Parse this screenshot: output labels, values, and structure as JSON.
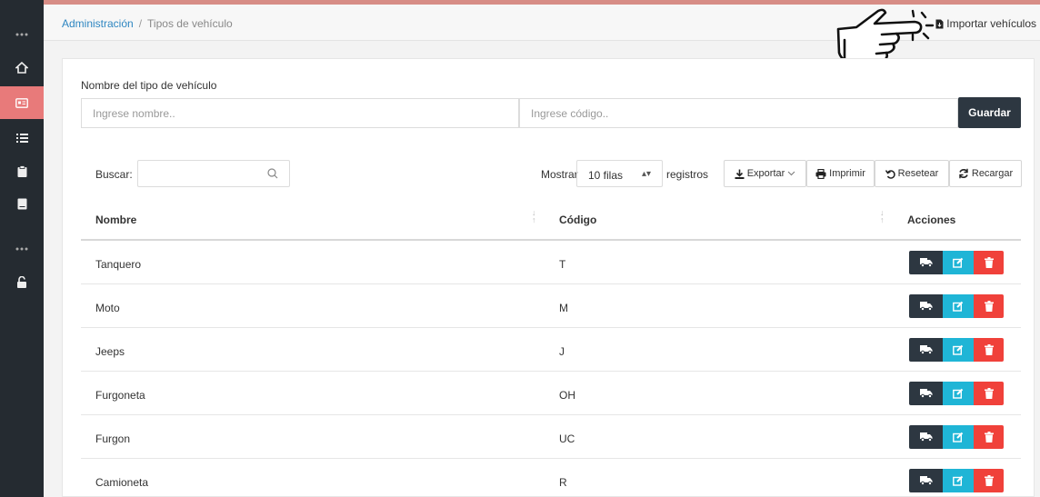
{
  "breadcrumb": {
    "root": "Administración",
    "separator": "/",
    "current": "Tipos de vehículo"
  },
  "header": {
    "import_label": "Importar vehículos"
  },
  "form": {
    "label": "Nombre del tipo de vehículo",
    "name_placeholder": "Ingrese nombre..",
    "code_placeholder": "Ingrese código..",
    "save_label": "Guardar"
  },
  "toolbar": {
    "search_label": "Buscar:",
    "show_label": "Mostrar",
    "rows_value": "10 filas",
    "records_label": "registros",
    "export_label": "Exportar",
    "print_label": "Imprimir",
    "reset_label": "Resetear",
    "reload_label": "Recargar"
  },
  "table": {
    "headers": [
      "Nombre",
      "Código",
      "Acciones"
    ],
    "rows": [
      {
        "name": "Tanquero",
        "code": "T"
      },
      {
        "name": "Moto",
        "code": "M"
      },
      {
        "name": "Jeeps",
        "code": "J"
      },
      {
        "name": "Furgoneta",
        "code": "OH"
      },
      {
        "name": "Furgon",
        "code": "UC"
      },
      {
        "name": "Camioneta",
        "code": "R"
      }
    ]
  },
  "colors": {
    "sidebar": "#252b31",
    "sidebar_active": "#e87a7a",
    "dark_button": "#2d3741",
    "edit_button": "#1fb5d6",
    "delete_button": "#f0413a",
    "link": "#2e86c1"
  }
}
